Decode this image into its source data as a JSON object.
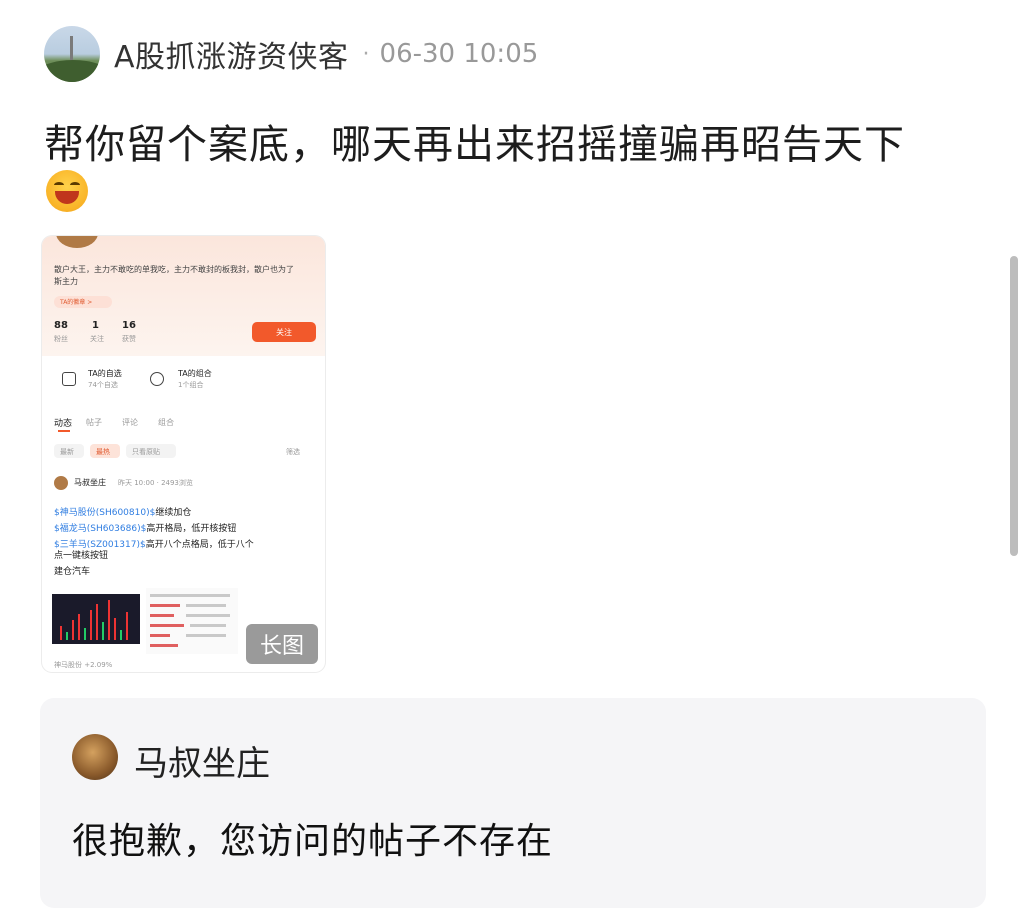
{
  "post": {
    "author": "A股抓涨游资侠客",
    "separator": "·",
    "time": "06-30 10:05",
    "text": "帮你留个案底，哪天再出来招摇撞骗再昭告天下",
    "emoji": "laughing-emoji"
  },
  "thumbnail": {
    "bio": "散户大王，主力不敢吃的单我吃，主力不敢封的板我封，散户也为了",
    "bio2": "斯主力",
    "tag": "TA的徽章 >",
    "stats": [
      {
        "num": "88",
        "label": "粉丝"
      },
      {
        "num": "1",
        "label": "关注"
      },
      {
        "num": "16",
        "label": "获赞"
      }
    ],
    "follow": "关注",
    "cards": [
      {
        "title": "TA的自选",
        "sub": "74个自选"
      },
      {
        "title": "TA的组合",
        "sub": "1个组合"
      }
    ],
    "tabs": [
      "动态",
      "帖子",
      "评论",
      "组合"
    ],
    "filters": [
      "最新",
      "最热",
      "只看原贴"
    ],
    "filter_right": "筛选",
    "post_author": "马叔坐庄",
    "post_meta": "昨天 10:00 · 2493浏览",
    "lines": [
      {
        "link": "$神马股份(SH600810)$",
        "rest": "继续加仓"
      },
      {
        "link": "$福龙马(SH603686)$",
        "rest": "高开格局，低开核按钮"
      },
      {
        "link": "$三羊马(SZ001317)$",
        "rest": "高开八个点格局，低于八个"
      },
      {
        "link": "",
        "rest": "点一键核按钮"
      },
      {
        "link": "",
        "rest": "建仓汽车"
      }
    ],
    "bottom_label": "神马股份 +2.09%",
    "long_image_badge": "长图"
  },
  "quote": {
    "name": "马叔坐庄",
    "text": "很抱歉，您访问的帖子不存在"
  },
  "colors": {
    "accent": "#f2592b",
    "link": "#2f7de1",
    "quote_bg": "#f5f5f7"
  }
}
